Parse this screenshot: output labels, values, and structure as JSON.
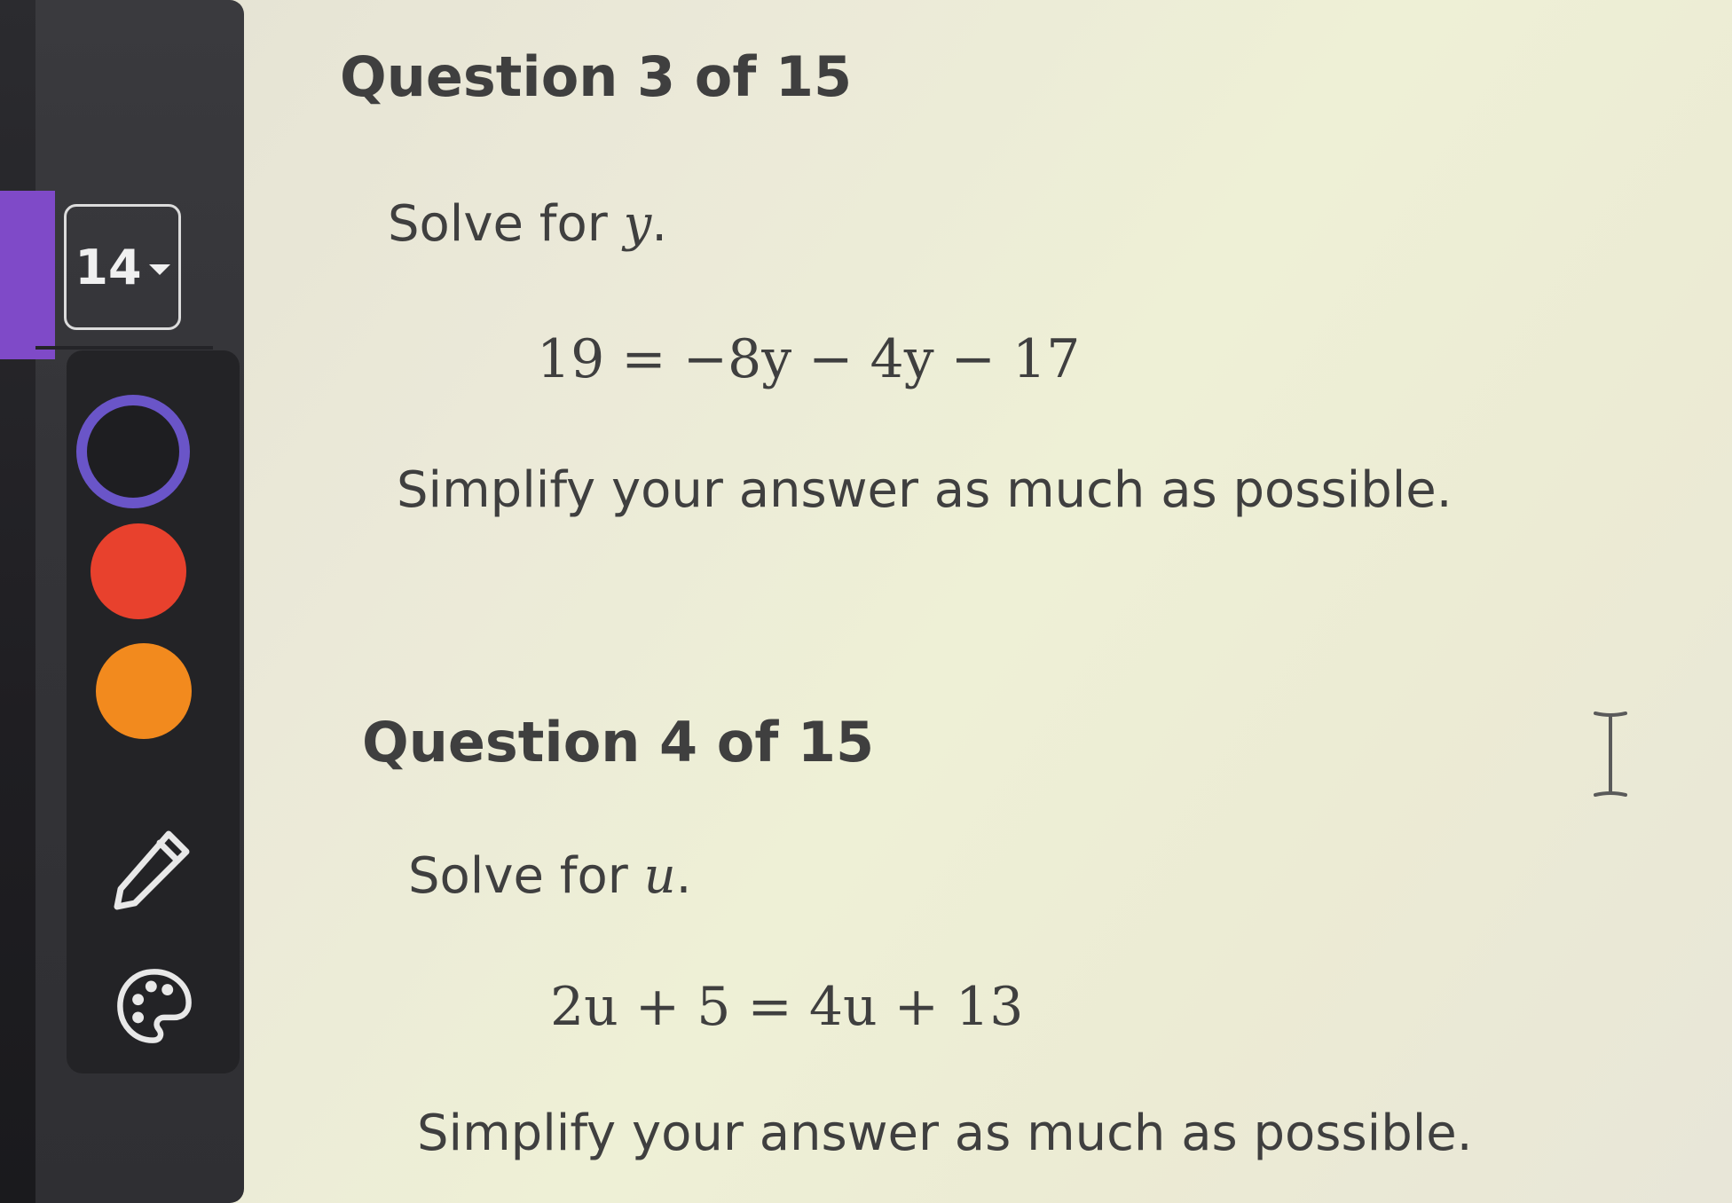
{
  "toolbar": {
    "page_selector": {
      "value": "14"
    },
    "colors": [
      {
        "name": "black",
        "hex": "#1e1e21",
        "selected": true,
        "ring": "#6a55c8"
      },
      {
        "name": "red",
        "hex": "#e8412d",
        "selected": false
      },
      {
        "name": "orange",
        "hex": "#f28a1e",
        "selected": false
      }
    ],
    "tools": [
      "pencil-icon",
      "palette-icon"
    ],
    "accent_color": "#7f4ac8"
  },
  "questions": [
    {
      "title": "Question 3 of 15",
      "prompt_text": "Solve for ",
      "variable": "y",
      "prompt_end": ".",
      "equation": "19 = −8y − 4y − 17",
      "instruction": "Simplify your answer as much as possible."
    },
    {
      "title": "Question 4 of 15",
      "prompt_text": "Solve for ",
      "variable": "u",
      "prompt_end": ".",
      "equation": "2u + 5 = 4u + 13",
      "instruction": "Simplify your answer as much as possible."
    }
  ],
  "cursor": "text-cursor-icon"
}
